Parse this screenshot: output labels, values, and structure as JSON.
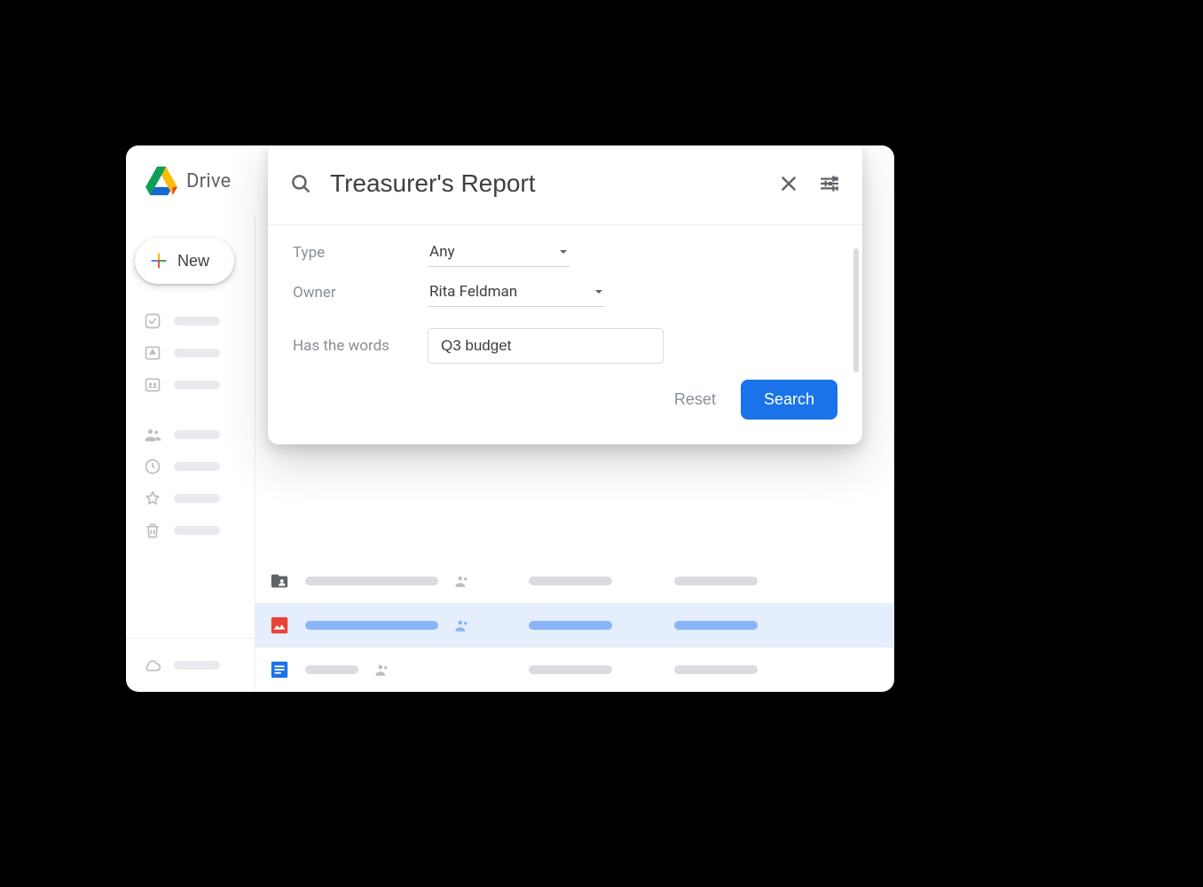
{
  "app": {
    "name": "Drive"
  },
  "sidebar": {
    "new_label": "New"
  },
  "search": {
    "query": "Treasurer's Report",
    "filters": {
      "type_label": "Type",
      "type_value": "Any",
      "owner_label": "Owner",
      "owner_value": "Rita Feldman",
      "words_label": "Has the words",
      "words_value": "Q3 budget"
    },
    "reset_label": "Reset",
    "search_label": "Search"
  }
}
